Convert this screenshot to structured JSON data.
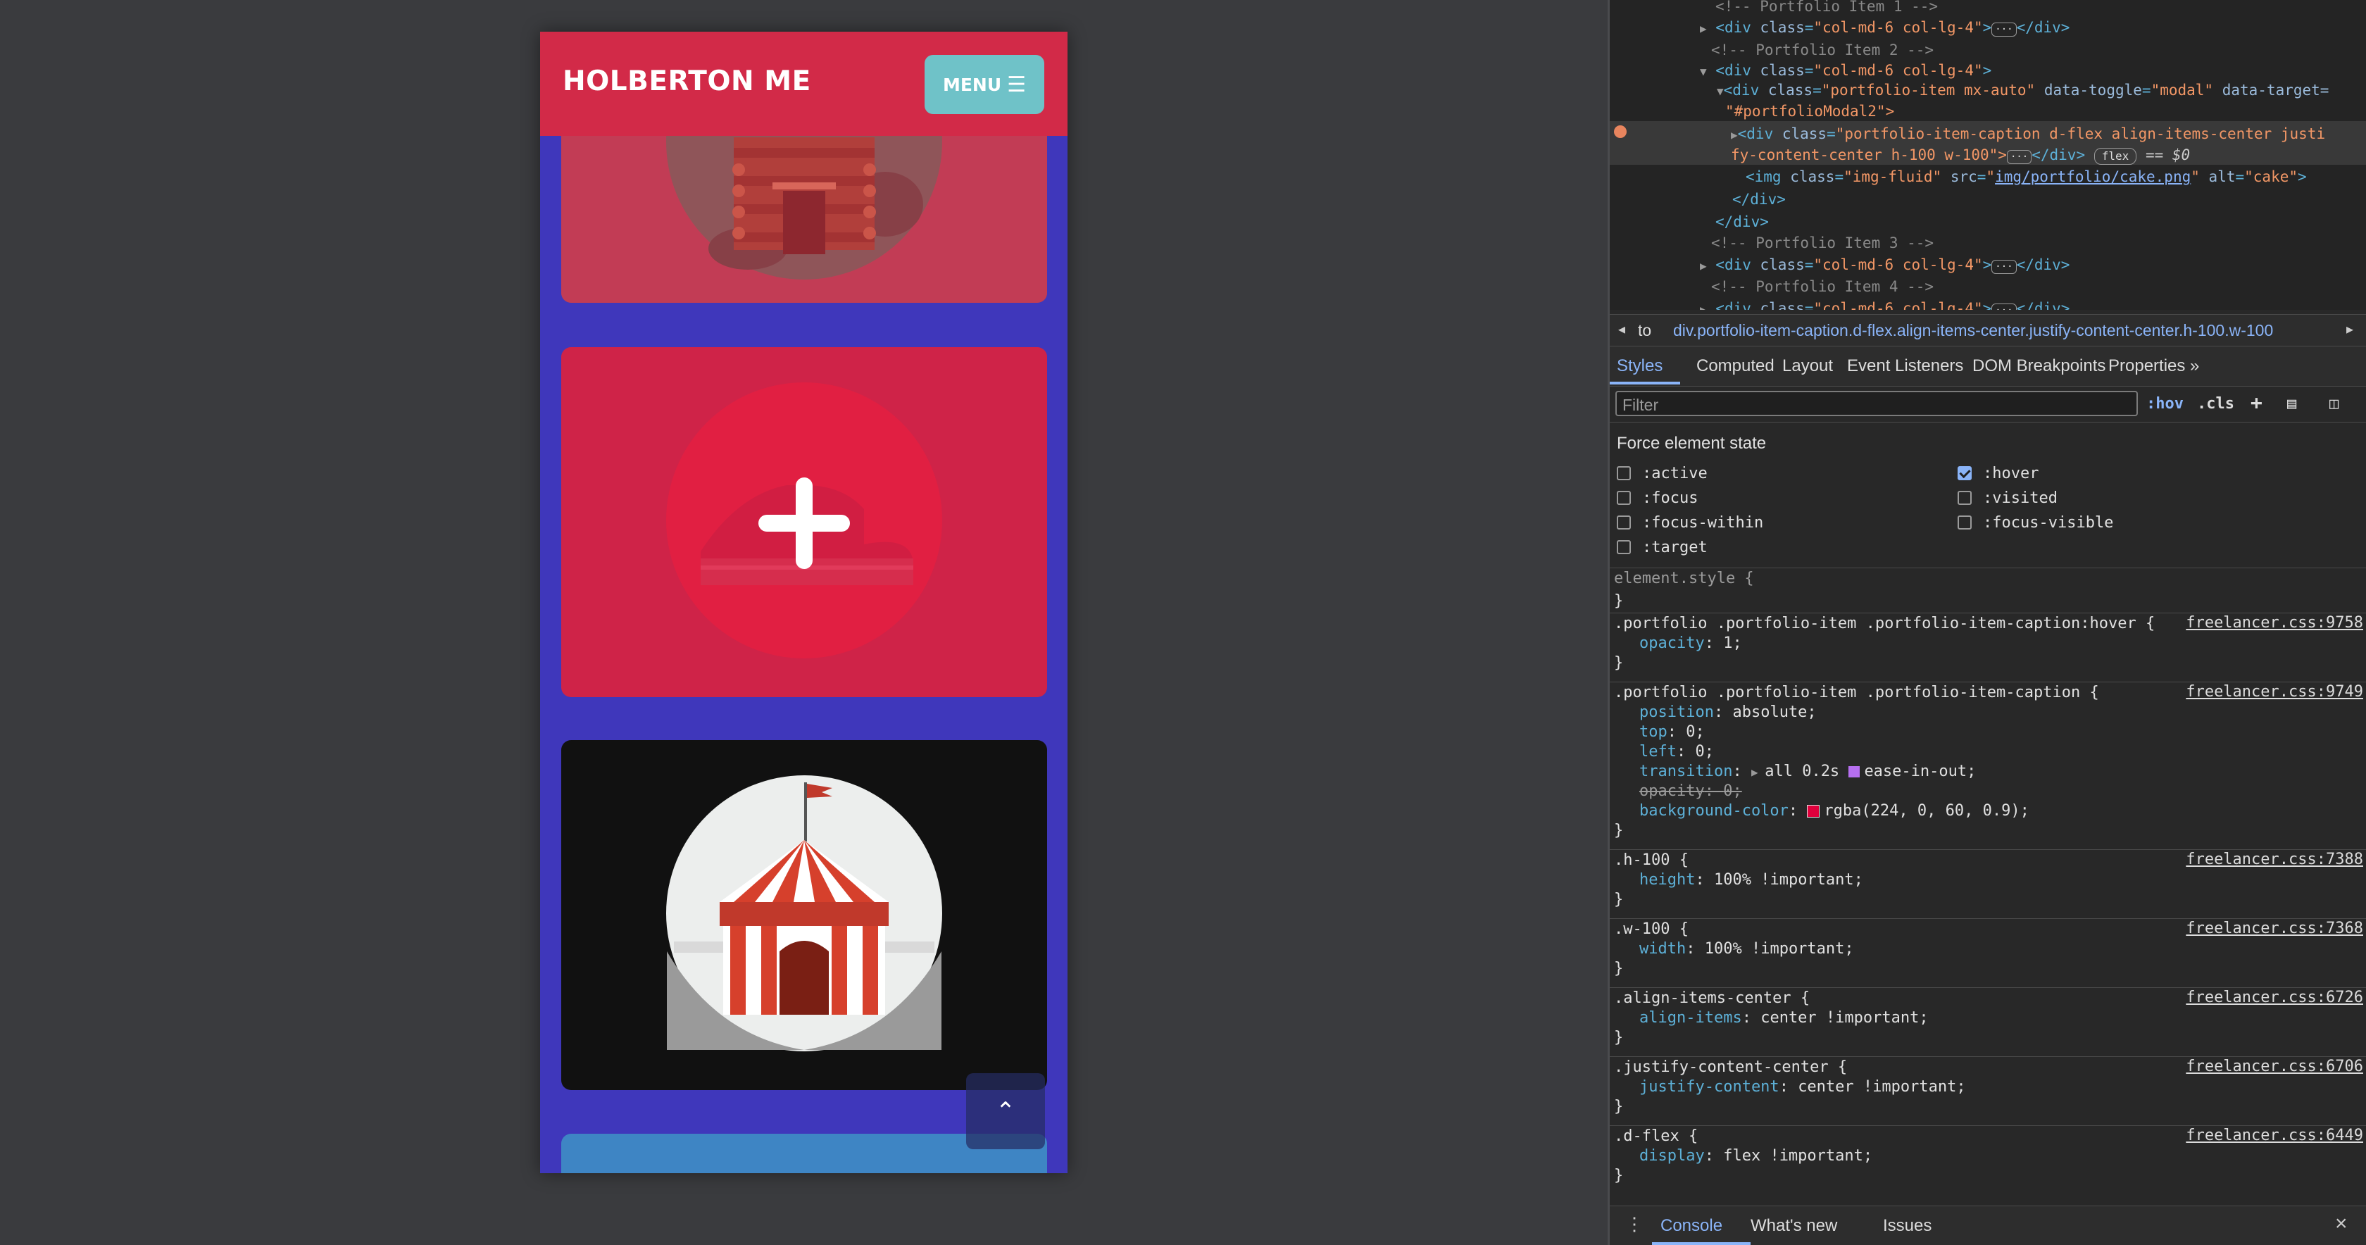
{
  "app": {
    "brand": "HOLBERTON ME",
    "menu_label": "MENU",
    "menu_icon": "hamburger-icon",
    "to_top_icon": "chevron-up-icon",
    "colors": {
      "navbar": "#d22a48",
      "menu": "#6fc2c8",
      "background": "#3f37bb",
      "overlay": "#e0003c"
    },
    "portfolio": [
      {
        "alt": "cabin"
      },
      {
        "alt": "cake",
        "hover_icon": "plus-icon"
      },
      {
        "alt": "circus"
      },
      {
        "alt": ""
      }
    ]
  },
  "devtools": {
    "dom_lines": [
      {
        "t": "comment",
        "text": "<!-- Portfolio Item 1 -->"
      },
      {
        "t": "c1",
        "text": "col-md-6 col-lg-4"
      },
      {
        "t": "comment",
        "text": "<!-- Portfolio Item 2 -->"
      },
      {
        "t": "c2",
        "text": "col-md-6 col-lg-4"
      },
      {
        "t": "c3a",
        "cls": "portfolio-item mx-auto",
        "toggle": "modal",
        "target_attr": "data-target=",
        "target_val": "\"#portfolioModal2\">"
      },
      {
        "t": "c4a",
        "cls_a": "portfolio-item-caption d-flex align-items-center justi",
        "cls_b": "fy-content-center h-100 w-100\">",
        "badge": "flex",
        "eq": "== $0"
      },
      {
        "t": "c5",
        "cls": "img-fluid",
        "src": "img/portfolio/cake.png",
        "alt": "cake"
      },
      {
        "t": "close",
        "text": "</div>"
      },
      {
        "t": "close",
        "text": "</div>"
      },
      {
        "t": "comment",
        "text": "<!-- Portfolio Item 3 -->"
      },
      {
        "t": "c1",
        "text": "col-md-6 col-lg-4"
      },
      {
        "t": "comment",
        "text": "<!-- Portfolio Item 4 -->"
      },
      {
        "t": "c1",
        "text": "col-md-6 col-lg-4"
      }
    ],
    "breadcrumb_prefix": "to",
    "breadcrumb": "div.portfolio-item-caption.d-flex.align-items-center.justify-content-center.h-100.w-100",
    "tabs": [
      "Styles",
      "Computed",
      "Layout",
      "Event Listeners",
      "DOM Breakpoints",
      "Properties",
      "»"
    ],
    "filter_placeholder": "Filter",
    "filter_buttons": [
      ":hov",
      ".cls"
    ],
    "force_state_title": "Force element state",
    "force_states": [
      {
        "label": ":active",
        "checked": false
      },
      {
        "label": ":hover",
        "checked": true
      },
      {
        "label": ":focus",
        "checked": false
      },
      {
        "label": ":visited",
        "checked": false
      },
      {
        "label": ":focus-within",
        "checked": false
      },
      {
        "label": ":focus-visible",
        "checked": false
      },
      {
        "label": ":target",
        "checked": false
      }
    ],
    "element_style": "element.style {",
    "rules": [
      {
        "selector": ".portfolio .portfolio-item .portfolio-item-caption:hover {",
        "source": "freelancer.css:9758",
        "decls": [
          {
            "p": "opacity",
            "v": "1;"
          }
        ]
      },
      {
        "selector": ".portfolio .portfolio-item .portfolio-item-caption {",
        "source": "freelancer.css:9749",
        "decls": [
          {
            "p": "position",
            "v": "absolute;"
          },
          {
            "p": "top",
            "v": "0;"
          },
          {
            "p": "left",
            "v": "0;"
          },
          {
            "p": "transition",
            "v": "all 0.2s",
            "v2": "ease-in-out;"
          },
          {
            "p": "opacity",
            "v": "0;",
            "struck": true
          },
          {
            "p": "background-color",
            "v": "rgba(224, 0, 60, 0.9);"
          }
        ]
      },
      {
        "selector": ".h-100 {",
        "source": "freelancer.css:7388",
        "decls": [
          {
            "p": "height",
            "v": "100% !important;"
          }
        ]
      },
      {
        "selector": ".w-100 {",
        "source": "freelancer.css:7368",
        "decls": [
          {
            "p": "width",
            "v": "100% !important;"
          }
        ]
      },
      {
        "selector": ".align-items-center {",
        "source": "freelancer.css:6726",
        "decls": [
          {
            "p": "align-items",
            "v": "center !important;"
          }
        ]
      },
      {
        "selector": ".justify-content-center {",
        "source": "freelancer.css:6706",
        "decls": [
          {
            "p": "justify-content",
            "v": "center !important;"
          }
        ]
      },
      {
        "selector": ".d-flex {",
        "source": "freelancer.css:6449",
        "decls": [
          {
            "p": "display",
            "v": "flex !important;"
          }
        ]
      }
    ],
    "close_brace": "}",
    "drawer_tabs": [
      "Console",
      "What's new",
      "Issues"
    ]
  }
}
